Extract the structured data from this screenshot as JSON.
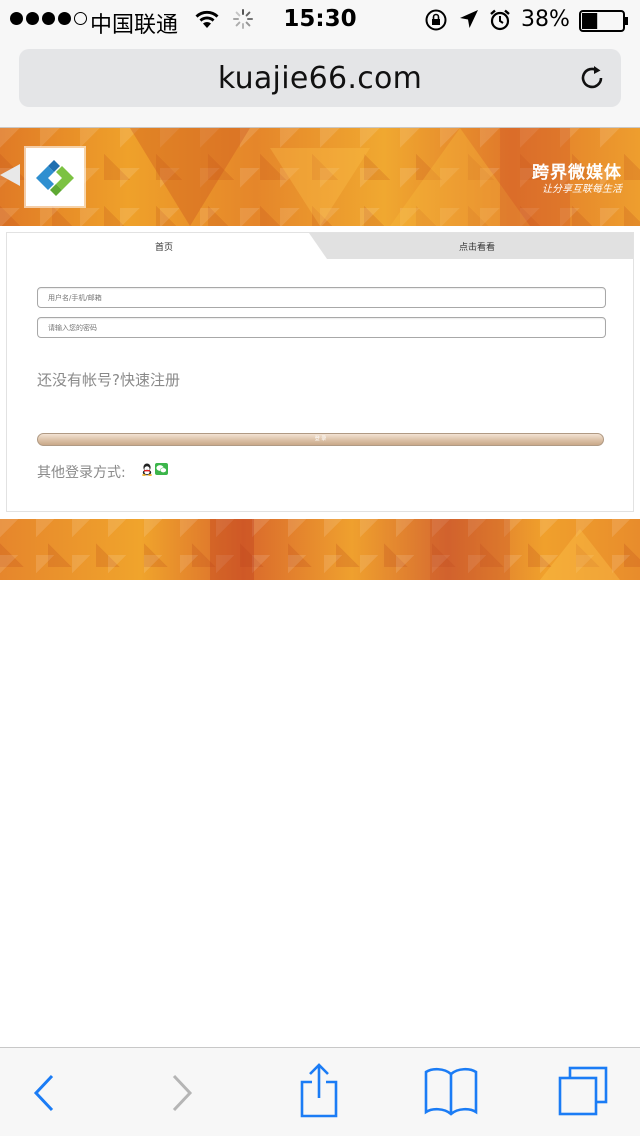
{
  "status_bar": {
    "carrier": "中国联通",
    "time": "15:30",
    "battery_percent": "38%",
    "battery_level": 0.38,
    "signal_bars_filled": 4,
    "signal_bars_total": 5
  },
  "browser": {
    "url": "kuajie66.com"
  },
  "banner": {
    "brand_name": "跨界微媒体",
    "slogan": "让分享互联每生活",
    "accent_color": "#e98c2a"
  },
  "tabs": [
    {
      "label": "首页"
    },
    {
      "label": "点击看看"
    }
  ],
  "login": {
    "username_placeholder": "用户名/手机/邮箱",
    "password_placeholder": "请输入您的密码",
    "no_account_text": "还没有帐号?",
    "register_link": "快速注册",
    "login_button": "登 录",
    "other_login_label": "其他登录方式:"
  },
  "icons": {
    "qq": "qq-icon",
    "wechat": "wechat-icon"
  }
}
